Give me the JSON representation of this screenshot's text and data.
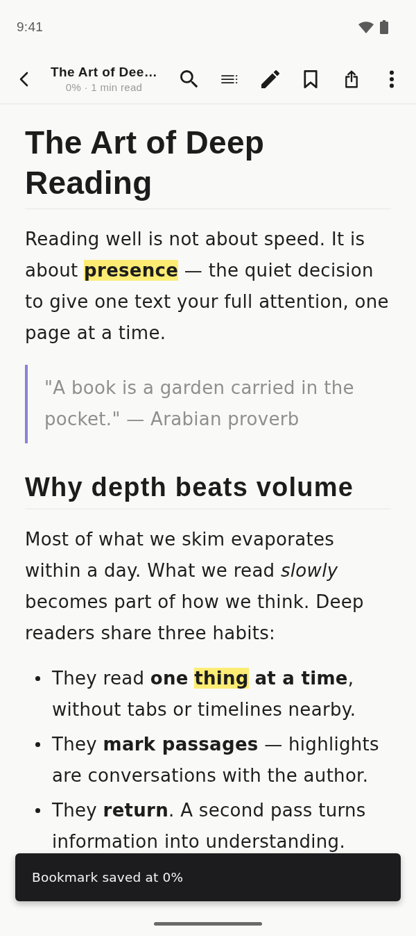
{
  "status_bar": {
    "time": "9:41"
  },
  "toolbar": {
    "title": "The Art of Dee…",
    "subtitle": "0% · 1 min read"
  },
  "article": {
    "title": "The Art of Deep Reading",
    "blocks": [
      {
        "kind": "paragraph",
        "runs": [
          {
            "text": "Reading well is not about speed. It is about ",
            "highlighted": false
          },
          {
            "text": "**presence**",
            "highlighted": true
          },
          {
            "text": " — the quiet decision to give one text your full attention, one page at a time.",
            "highlighted": false
          }
        ]
      },
      {
        "kind": "quote",
        "text": "\"A book is a garden carried in the pocket.\" — Arabian proverb"
      },
      {
        "kind": "heading",
        "text": "Why depth beats volume"
      },
      {
        "kind": "paragraph",
        "runs": [
          {
            "text": "Most of what we skim evaporates within a day. What we read *slowly* becomes part of how we think. Deep readers share three habits:",
            "highlighted": false
          }
        ]
      },
      {
        "kind": "list",
        "items": [
          {
            "runs": [
              {
                "text": "They read **one** ",
                "highlighted": false
              },
              {
                "text": "**thing**",
                "highlighted": true
              },
              {
                "text": " **at a time**, without tabs or timelines nearby.",
                "highlighted": false
              }
            ]
          },
          {
            "runs": [
              {
                "text": "They **mark passages** — highlights are conversations with the author.",
                "highlighted": false
              }
            ]
          },
          {
            "runs": [
              {
                "text": "They **return**. A second pass turns information into understanding.",
                "highlighted": false
              }
            ]
          }
        ]
      }
    ]
  },
  "toast": {
    "message": "Bookmark saved at 0%"
  }
}
